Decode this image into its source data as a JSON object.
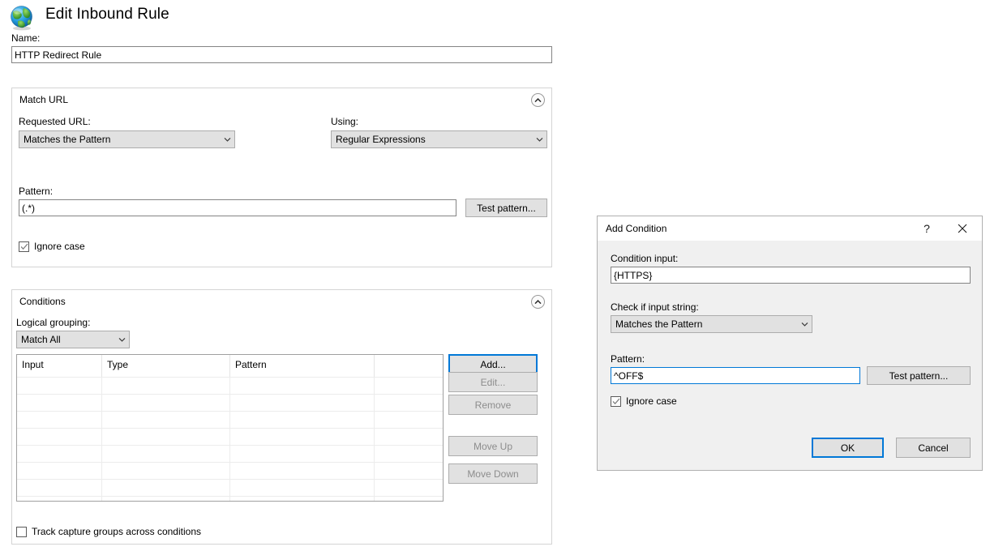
{
  "page": {
    "icon": "globe-icon",
    "title": "Edit Inbound Rule",
    "name_label": "Name:",
    "name_value": "HTTP Redirect Rule"
  },
  "match_url": {
    "title": "Match URL",
    "collapse_icon": "chevron-up-icon",
    "requested_url_label": "Requested URL:",
    "requested_url_value": "Matches the Pattern",
    "using_label": "Using:",
    "using_value": "Regular Expressions",
    "pattern_label": "Pattern:",
    "pattern_value": "(.*)",
    "test_pattern_label": "Test pattern...",
    "ignore_case_label": "Ignore case",
    "ignore_case_checked": true
  },
  "conditions": {
    "title": "Conditions",
    "collapse_icon": "chevron-up-icon",
    "logical_grouping_label": "Logical grouping:",
    "logical_grouping_value": "Match All",
    "columns": [
      "Input",
      "Type",
      "Pattern",
      ""
    ],
    "rows": [],
    "empty_row_count": 8,
    "buttons": [
      {
        "label": "Add...",
        "enabled": true,
        "focused": true
      },
      {
        "label": "Edit...",
        "enabled": false,
        "focused": false
      },
      {
        "label": "Remove",
        "enabled": false,
        "focused": false
      },
      {
        "label": "Move Up",
        "enabled": false,
        "focused": false
      },
      {
        "label": "Move Down",
        "enabled": false,
        "focused": false
      }
    ],
    "track_capture_label": "Track capture groups across conditions",
    "track_capture_checked": false
  },
  "add_condition_dialog": {
    "title": "Add Condition",
    "help_icon": "question-mark-icon",
    "close_icon": "close-icon",
    "condition_input_label": "Condition input:",
    "condition_input_value": "{HTTPS}",
    "check_if_label": "Check if input string:",
    "check_if_value": "Matches the Pattern",
    "pattern_label": "Pattern:",
    "pattern_value": "^OFF$",
    "pattern_focused": true,
    "test_pattern_label": "Test pattern...",
    "ignore_case_label": "Ignore case",
    "ignore_case_checked": true,
    "ok_label": "OK",
    "cancel_label": "Cancel"
  },
  "colors": {
    "accent": "#0078d7",
    "page_bg": "#ffffff",
    "dialog_bg": "#f0f0f0",
    "control_bg": "#e1e1e1",
    "border": "#d4d4d4",
    "disabled_text": "#8d8d8d"
  }
}
